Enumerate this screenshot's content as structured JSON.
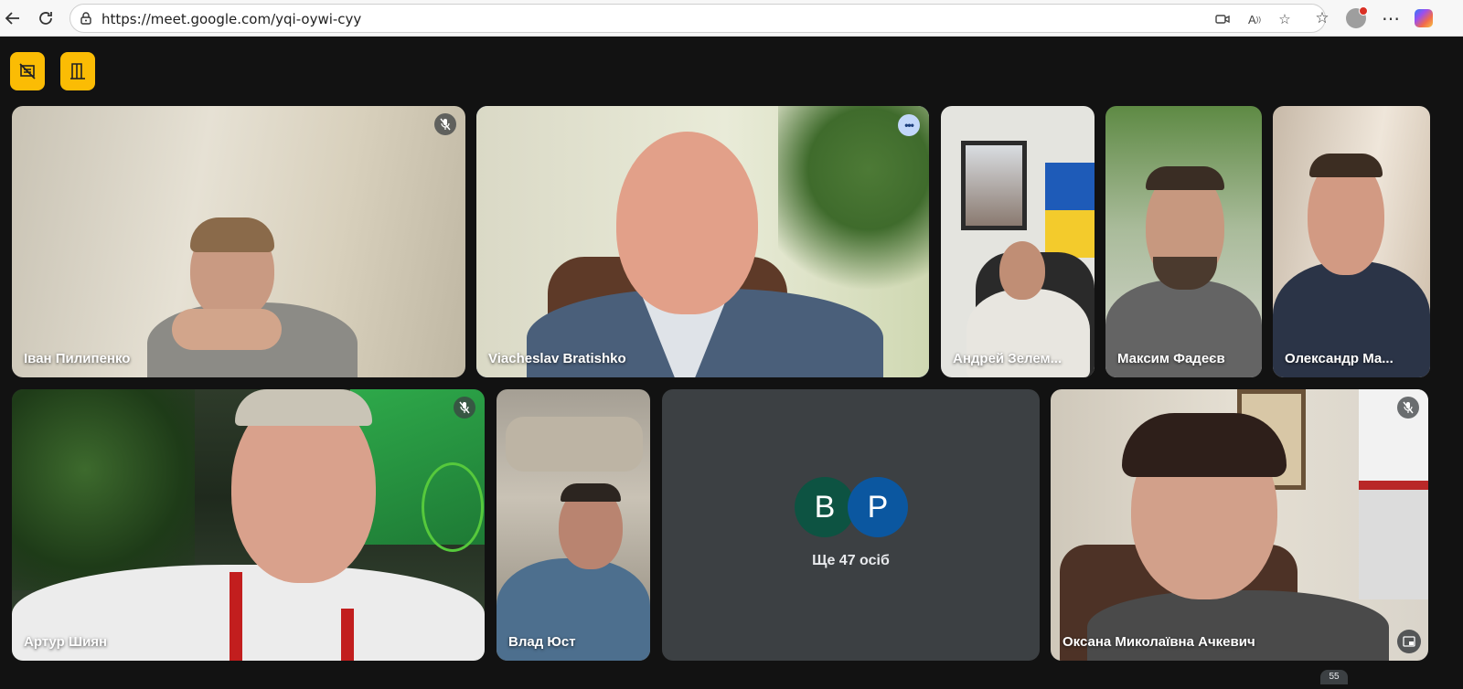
{
  "browser": {
    "url": "https://meet.google.com/yqi-oywi-cyy"
  },
  "meet": {
    "controls": [
      {
        "icon": "present-off-icon"
      },
      {
        "icon": "door-exit-icon"
      }
    ],
    "participants": {
      "ivan": {
        "name": "Іван Пилипенко",
        "muted": true
      },
      "viacheslav": {
        "name": "Viacheslav Bratishko",
        "speaking": true
      },
      "andrei": {
        "name": "Андрей Зелем..."
      },
      "maksym": {
        "name": "Максим Фадеєв"
      },
      "oleksandr": {
        "name": "Олександр Ма..."
      },
      "artur": {
        "name": "Артур Шиян",
        "muted": true
      },
      "vlad": {
        "name": "Влад Юст"
      },
      "oksana": {
        "name": "Оксана Миколаївна Ачкевич",
        "muted": true
      }
    },
    "others": {
      "avatars": [
        {
          "letter": "B",
          "color": "#0d5342"
        },
        {
          "letter": "P",
          "color": "#0b57a0"
        }
      ],
      "label": "Ще 47 осіб"
    },
    "scroll_badge": "55"
  },
  "colors": {
    "accent": "#fbbc04",
    "speaking_border": "#8ab4f8",
    "tile_empty": "#3c4043"
  }
}
